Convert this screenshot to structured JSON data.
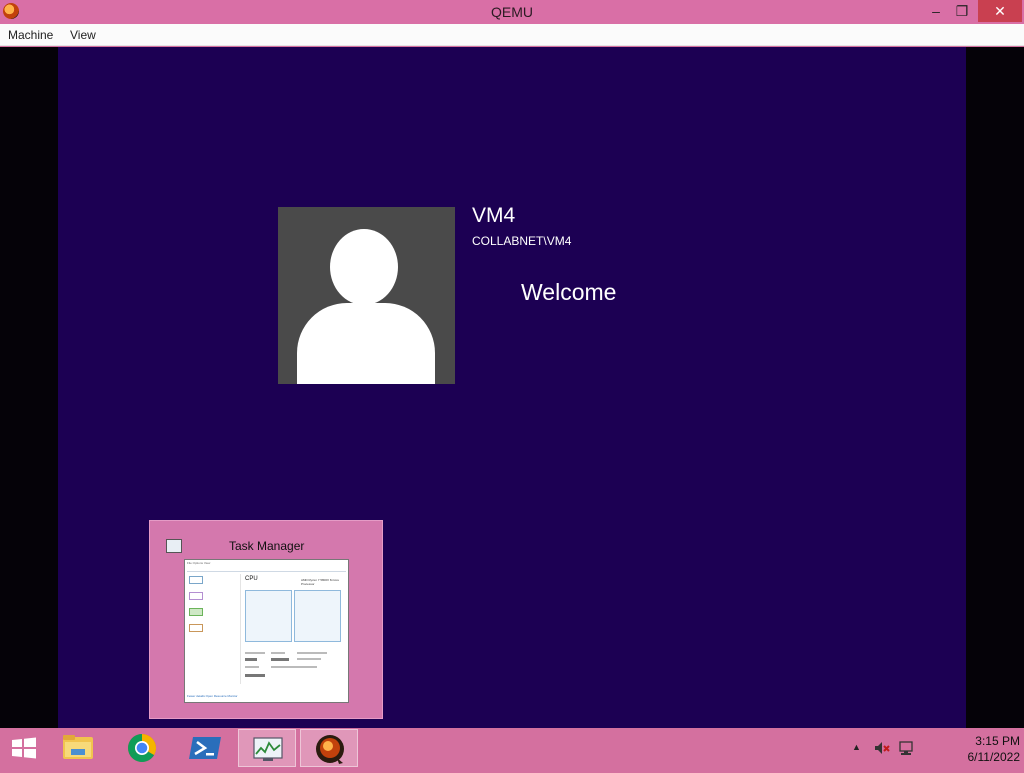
{
  "window": {
    "title": "QEMU",
    "controls": {
      "minimize": "–",
      "restore": "❐",
      "close": "✕"
    }
  },
  "menubar": {
    "items": [
      "Machine",
      "View"
    ]
  },
  "login": {
    "user_name": "VM4",
    "user_domain": "COLLABNET\\VM4",
    "status": "Welcome"
  },
  "thumbnail": {
    "title": "Task Manager",
    "menu": "File  Options  View",
    "cpu_label": "CPU",
    "cpu_name": "AMD Ryzen 7 5800X 8-Core Processor",
    "footer": "Fewer details   Open Resource Monitor"
  },
  "taskbar": {
    "apps": [
      "start",
      "file-explorer",
      "chrome",
      "powershell",
      "task-manager",
      "qemu"
    ],
    "active": [
      "task-manager",
      "qemu"
    ]
  },
  "tray": {
    "arrow": "▲",
    "time": "3:15 PM",
    "date": "6/11/2022"
  },
  "colors": {
    "titlebar": "#d96fa6",
    "guest_background": "#1c0053",
    "taskbar": "#d4709f",
    "close_button": "#c94050"
  }
}
